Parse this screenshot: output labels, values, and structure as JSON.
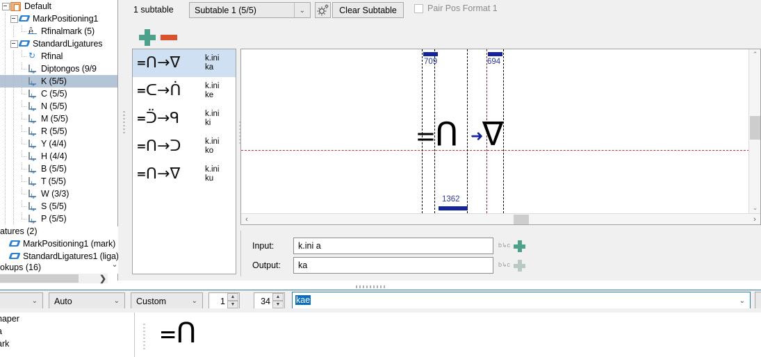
{
  "tree": {
    "items": [
      {
        "label": "Default",
        "depth": 0,
        "icon": "folder-icon",
        "expander": true,
        "selected": false
      },
      {
        "label": "MarkPositioning1",
        "depth": 1,
        "icon": "lookup-tag-icon",
        "expander": true,
        "selected": false
      },
      {
        "label": "Rfinalmark (5)",
        "depth": 2,
        "icon": "mark-accent-icon",
        "expander": false,
        "selected": false
      },
      {
        "label": "StandardLigatures",
        "depth": 1,
        "icon": "lookup-tag-icon",
        "expander": true,
        "selected": false
      },
      {
        "label": "Rfinal",
        "depth": 2,
        "icon": "recycle-icon",
        "expander": false,
        "selected": false
      },
      {
        "label": "Diptongos (9/9",
        "depth": 2,
        "icon": "ligature-subtable-icon",
        "expander": false,
        "selected": false
      },
      {
        "label": "K (5/5)",
        "depth": 2,
        "icon": "ligature-subtable-icon",
        "expander": false,
        "selected": true
      },
      {
        "label": "C (5/5)",
        "depth": 2,
        "icon": "ligature-subtable-icon",
        "expander": false,
        "selected": false
      },
      {
        "label": "N (5/5)",
        "depth": 2,
        "icon": "ligature-subtable-icon",
        "expander": false,
        "selected": false
      },
      {
        "label": "M (5/5)",
        "depth": 2,
        "icon": "ligature-subtable-icon",
        "expander": false,
        "selected": false
      },
      {
        "label": "R (5/5)",
        "depth": 2,
        "icon": "ligature-subtable-icon",
        "expander": false,
        "selected": false
      },
      {
        "label": "Y (4/4)",
        "depth": 2,
        "icon": "ligature-subtable-icon",
        "expander": false,
        "selected": false
      },
      {
        "label": "H (4/4)",
        "depth": 2,
        "icon": "ligature-subtable-icon",
        "expander": false,
        "selected": false
      },
      {
        "label": "B (5/5)",
        "depth": 2,
        "icon": "ligature-subtable-icon",
        "expander": false,
        "selected": false
      },
      {
        "label": "T (5/5)",
        "depth": 2,
        "icon": "ligature-subtable-icon",
        "expander": false,
        "selected": false
      },
      {
        "label": "W (3/3)",
        "depth": 2,
        "icon": "ligature-subtable-icon",
        "expander": false,
        "selected": false
      },
      {
        "label": "S (5/5)",
        "depth": 2,
        "icon": "ligature-subtable-icon",
        "expander": false,
        "selected": false
      },
      {
        "label": "P (5/5)",
        "depth": 2,
        "icon": "ligature-subtable-icon",
        "expander": false,
        "selected": false
      }
    ]
  },
  "features": {
    "header": "atures (2)",
    "items": [
      {
        "label": "MarkPositioning1 (mark)",
        "icon": "lookup-tag-icon"
      },
      {
        "label": "StandardLigatures1 (liga)",
        "icon": "lookup-tag-icon"
      }
    ],
    "footer": "okups (16)",
    "chevron": "⌄",
    "more": "❯"
  },
  "toolbar": {
    "subtable_count": "1 subtable",
    "subtable_selected": "Subtable 1 (5/5)",
    "clear_subtable": "Clear Subtable",
    "pair_pos_label": "Pair Pos Format 1",
    "pair_pos_checked": false,
    "chevron": "⌄",
    "add_label": "+",
    "remove_label": "−"
  },
  "pairs": {
    "rows": [
      {
        "glyphs": "᐀ᑎ→ᐁ",
        "name_line1": "k.ini",
        "name_line2": "ka",
        "selected": true
      },
      {
        "glyphs": "᐀ᑕ→ᑏ",
        "name_line1": "k.ini",
        "name_line2": "ke",
        "selected": false
      },
      {
        "glyphs": "᐀ᑒ→ᑫ",
        "name_line1": "k.ini",
        "name_line2": "ki",
        "selected": false
      },
      {
        "glyphs": "᐀ᑎ→ᑐ",
        "name_line1": "k.ini",
        "name_line2": "ko",
        "selected": false
      },
      {
        "glyphs": "᐀ᑎ→ᐁ",
        "name_line1": "k.ini",
        "name_line2": "ku",
        "selected": false
      }
    ]
  },
  "canvas": {
    "left_advance": "709",
    "right_advance": "694",
    "total_advance": "1362",
    "input_glyph": "᐀ᑎ",
    "arrow": "➜",
    "output_glyph": "ᐁ",
    "baseline_color": "#c23030",
    "advance_bar_color": "#14249c",
    "hscroll_left_arrow": "‹",
    "hscroll_right_arrow": "›",
    "vscroll_up_arrow": "⌃",
    "vscroll_down_arrow": "⌄"
  },
  "io": {
    "input_label": "Input:",
    "input_value": "k.ini a",
    "output_label": "Output:",
    "output_value": "ka",
    "bc_icon": "b↳c",
    "add_icon": "+"
  },
  "bottombar": {
    "combo0_value": "",
    "combo1_value": "Auto",
    "combo2_value": "Custom",
    "spin1_value": "1",
    "spin2_value": "34",
    "text_value": "kae",
    "chevron": "⌄",
    "spin_up": "▲",
    "spin_down": "▼"
  },
  "bottom_panel": {
    "rows": [
      "haper",
      "a",
      "ark"
    ],
    "preview_glyph": "᐀ᑎ"
  },
  "colors": {
    "selection_blue": "#cfe0f2",
    "tree_selection": "#b5c5d8",
    "accent_blue": "#14249c",
    "text_highlight": "#0a6ebd",
    "plus_green": "#4da08a",
    "minus_orange": "#d9522e"
  }
}
